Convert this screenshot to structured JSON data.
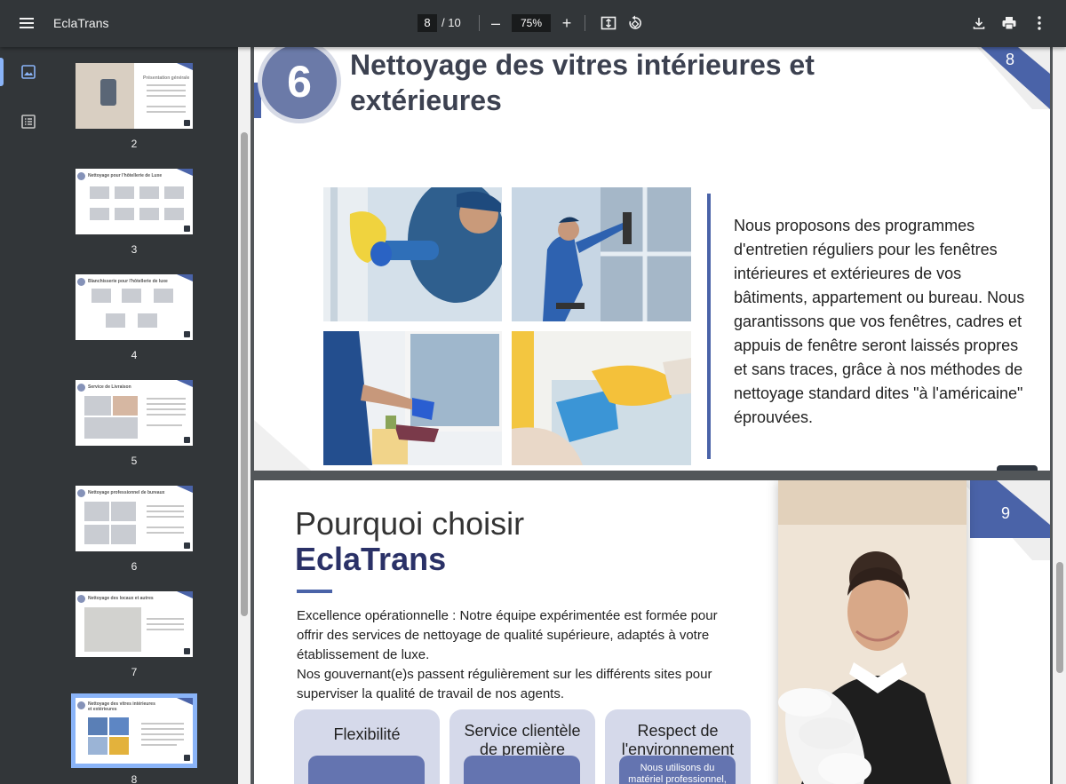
{
  "toolbar": {
    "title": "EclaTrans",
    "current_page": "8",
    "total_pages": "/ 10",
    "zoom": "75%",
    "zoom_out_label": "–",
    "zoom_in_label": "+"
  },
  "thumbnails": [
    {
      "label": "2",
      "title": "Présentation générale",
      "selected": false
    },
    {
      "label": "3",
      "title": "Nettoyage pour l'hôtellerie de Luxe",
      "selected": false
    },
    {
      "label": "4",
      "title": "Blanchisserie pour l'hôtellerie de luxe",
      "selected": false
    },
    {
      "label": "5",
      "title": "Service de Livraison",
      "selected": false
    },
    {
      "label": "6",
      "title": "Nettoyage professionnel de bureaux",
      "selected": false
    },
    {
      "label": "7",
      "title": "Nettoyage des locaux et autres",
      "selected": false
    },
    {
      "label": "8",
      "title": "Nettoyage des vitres intérieures et extérieures",
      "selected": true
    }
  ],
  "page8": {
    "number": "6",
    "title": "Nettoyage des vitres intérieures et extérieures",
    "page_number": "8",
    "body": "Nous proposons des programmes d'entretien réguliers pour les fenêtres intérieures et extérieures de vos bâtiments, appartement ou bureau. Nous garantissons que vos fenêtres, cadres et appuis de fenêtre seront laissés propres et sans traces, grâce à nos méthodes de nettoyage standard dites \"à l'américaine\" éprouvées."
  },
  "page9": {
    "page_number": "9",
    "heading_line1": "Pourquoi choisir",
    "heading_line2": "EclaTrans",
    "paragraph1": "Excellence opérationnelle : Notre équipe expérimentée est formée pour offrir des services de nettoyage de qualité supérieure, adaptés à votre établissement de luxe.",
    "paragraph2": "Nos gouvernant(e)s passent régulièrement sur les différents sites pour superviser la qualité de travail de nos agents.",
    "cards": [
      {
        "title": "Flexibilité",
        "body": ""
      },
      {
        "title": "Service clientèle de première classe",
        "body": ""
      },
      {
        "title": "Respect de l'environnement",
        "body": "Nous utilisons du matériel professionnel, des"
      }
    ]
  },
  "colors": {
    "accent": "#4a63a8",
    "navy": "#2a3167",
    "toolbar": "#323639"
  }
}
